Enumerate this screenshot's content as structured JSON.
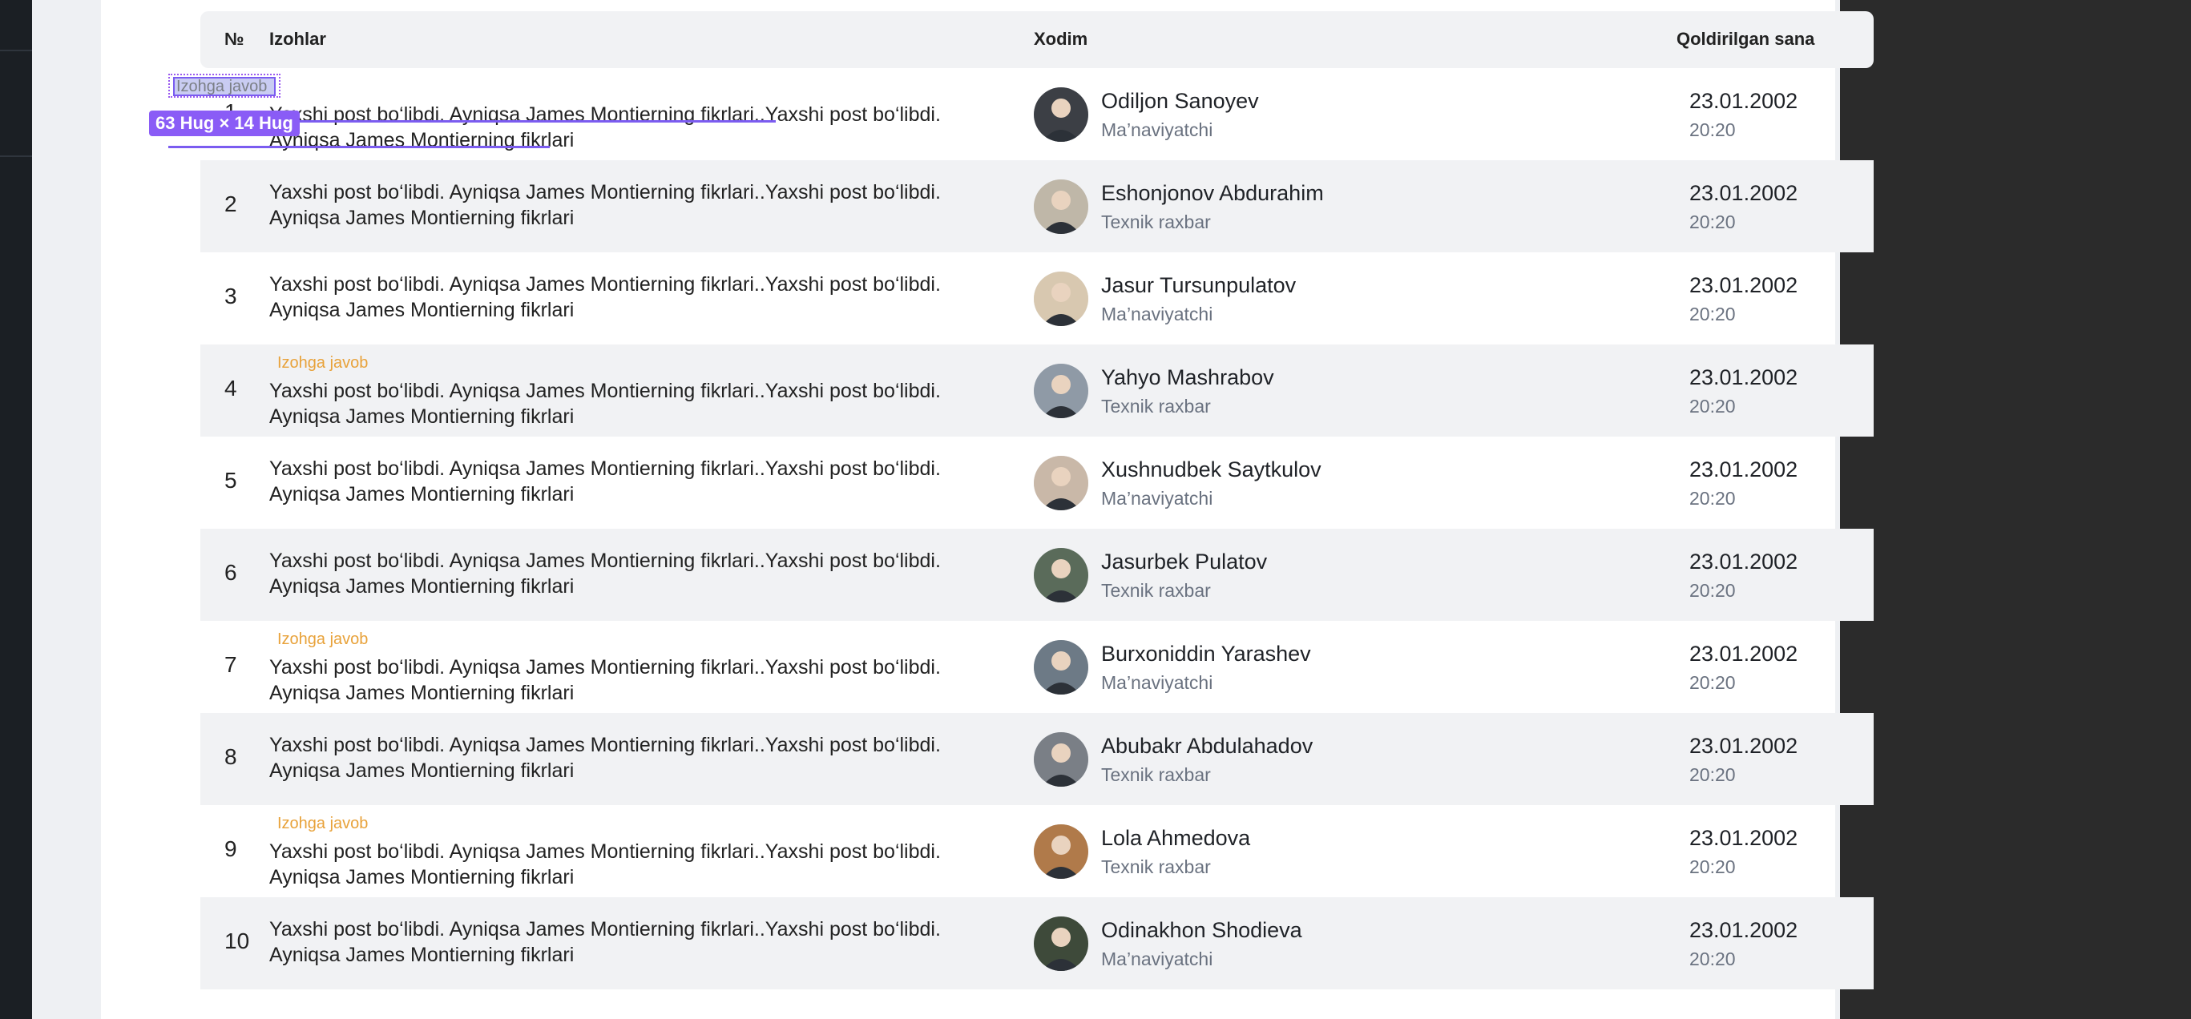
{
  "table": {
    "headers": {
      "num": "№",
      "comments": "Izohlar",
      "employee": "Xodim",
      "date": "Qoldirilgan sana"
    },
    "rows": [
      {
        "num": "1",
        "reply": "Izohga javob",
        "comment": "Yaxshi post bo‘libdi. Ayniqsa James Montierning fikrlari..Yaxshi post bo‘libdi. Ayniqsa James Montierning fikrlari",
        "name": "Odiljon Sanoyev",
        "role": "Ma’naviyatchi",
        "date": "23.01.2002",
        "time": "20:20"
      },
      {
        "num": "2",
        "reply": "",
        "comment": "Yaxshi post bo‘libdi. Ayniqsa James Montierning fikrlari..Yaxshi post bo‘libdi. Ayniqsa James Montierning fikrlari",
        "name": "Eshonjonov Abdurahim",
        "role": "Texnik raxbar",
        "date": "23.01.2002",
        "time": "20:20"
      },
      {
        "num": "3",
        "reply": "",
        "comment": "Yaxshi post bo‘libdi. Ayniqsa James Montierning fikrlari..Yaxshi post bo‘libdi. Ayniqsa James Montierning fikrlari",
        "name": "Jasur Tursunpulatov",
        "role": "Ma’naviyatchi",
        "date": "23.01.2002",
        "time": "20:20"
      },
      {
        "num": "4",
        "reply": "Izohga javob",
        "comment": "Yaxshi post bo‘libdi. Ayniqsa James Montierning fikrlari..Yaxshi post bo‘libdi. Ayniqsa James Montierning fikrlari",
        "name": "Yahyo Mashrabov",
        "role": "Texnik raxbar",
        "date": "23.01.2002",
        "time": "20:20"
      },
      {
        "num": "5",
        "reply": "",
        "comment": "Yaxshi post bo‘libdi. Ayniqsa James Montierning fikrlari..Yaxshi post bo‘libdi. Ayniqsa James Montierning fikrlari",
        "name": "Xushnudbek Saytkulov",
        "role": "Ma’naviyatchi",
        "date": "23.01.2002",
        "time": "20:20"
      },
      {
        "num": "6",
        "reply": "",
        "comment": "Yaxshi post bo‘libdi. Ayniqsa James Montierning fikrlari..Yaxshi post bo‘libdi. Ayniqsa James Montierning fikrlari",
        "name": "Jasurbek Pulatov",
        "role": "Texnik raxbar",
        "date": "23.01.2002",
        "time": "20:20"
      },
      {
        "num": "7",
        "reply": "Izohga javob",
        "comment": "Yaxshi post bo‘libdi. Ayniqsa James Montierning fikrlari..Yaxshi post bo‘libdi. Ayniqsa James Montierning fikrlari",
        "name": "Burxoniddin Yarashev",
        "role": "Ma’naviyatchi",
        "date": "23.01.2002",
        "time": "20:20"
      },
      {
        "num": "8",
        "reply": "",
        "comment": "Yaxshi post bo‘libdi. Ayniqsa James Montierning fikrlari..Yaxshi post bo‘libdi. Ayniqsa James Montierning fikrlari",
        "name": "Abubakr Abdulahadov",
        "role": "Texnik raxbar",
        "date": "23.01.2002",
        "time": "20:20"
      },
      {
        "num": "9",
        "reply": "Izohga javob",
        "comment": "Yaxshi post bo‘libdi. Ayniqsa James Montierning fikrlari..Yaxshi post bo‘libdi. Ayniqsa James Montierning fikrlari",
        "name": "Lola Ahmedova",
        "role": "Texnik raxbar",
        "date": "23.01.2002",
        "time": "20:20"
      },
      {
        "num": "10",
        "reply": "",
        "comment": "Yaxshi post bo‘libdi. Ayniqsa James Montierning fikrlari..Yaxshi post bo‘libdi. Ayniqsa James Montierning fikrlari",
        "name": "Odinakhon Shodieva",
        "role": "Ma’naviyatchi",
        "date": "23.01.2002",
        "time": "20:20"
      }
    ]
  },
  "selection": {
    "label": "Izohga javob",
    "size_tag": "63 Hug × 14 Hug"
  },
  "colors": {
    "accent_reply": "#e8a23a",
    "selection": "#8a5cf6",
    "row_alt": "#f1f2f4"
  }
}
